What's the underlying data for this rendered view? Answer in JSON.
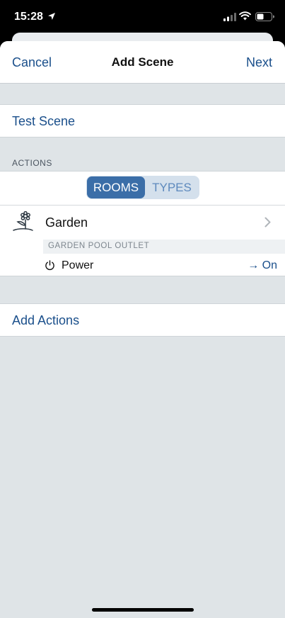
{
  "status_bar": {
    "time": "15:28",
    "icons": [
      "location-arrow-icon",
      "cellular-signal-icon",
      "wifi-icon",
      "battery-icon"
    ]
  },
  "nav": {
    "cancel_label": "Cancel",
    "title": "Add Scene",
    "next_label": "Next"
  },
  "scene": {
    "name": "Test Scene"
  },
  "actions": {
    "section_header": "ACTIONS",
    "segments": [
      {
        "label": "ROOMS",
        "selected": true
      },
      {
        "label": "TYPES",
        "selected": false
      }
    ],
    "room": {
      "name": "Garden",
      "icon": "flower-icon",
      "accessory": {
        "name": "GARDEN POOL OUTLET",
        "characteristic": "Power",
        "value": "→ On"
      }
    }
  },
  "add_actions_label": "Add Actions",
  "colors": {
    "accent": "#1a4f8b",
    "segment_selected": "#3b6ea8",
    "segment_background": "#d4e0ec",
    "background": "#dfe4e7"
  }
}
